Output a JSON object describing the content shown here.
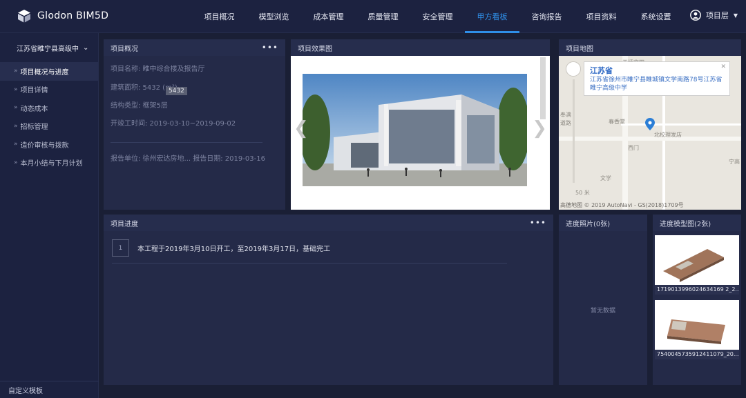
{
  "app": {
    "title": "Glodon BIM5D"
  },
  "nav": {
    "items": [
      "项目概况",
      "模型浏览",
      "成本管理",
      "质量管理",
      "安全管理",
      "甲方看板",
      "咨询报告",
      "项目资料",
      "系统设置"
    ],
    "active": "甲方看板"
  },
  "user": {
    "name": "项目层"
  },
  "sidebar": {
    "org_selector": "江苏省睢宁县高级中",
    "items": [
      {
        "label": "项目概况与进度",
        "active": true
      },
      {
        "label": "项目详情"
      },
      {
        "label": "动态成本"
      },
      {
        "label": "招标管理"
      },
      {
        "label": "造价审核与拨款"
      },
      {
        "label": "本月小结与下月计划"
      }
    ],
    "footer": "自定义模板"
  },
  "overview": {
    "title": "项目概况",
    "name": "项目名称: 睢中综合楼及报告厅",
    "area": "建筑面积: 5432 (m²)",
    "area_tooltip": "5432",
    "structure": "结构类型: 框架5层",
    "dates": "开竣工时间: 2019-03-10~2019-09-02",
    "report": "报告单位: 徐州宏达房地... 报告日期: 2019-03-16"
  },
  "effect": {
    "title": "项目效果图",
    "prev": "❮",
    "next": "❯"
  },
  "map": {
    "title": "项目地图",
    "popup_title": "江苏省",
    "popup_address": "江苏省徐州市睢宁县睢城镇文学南路78号江苏省睢宁高级中学",
    "labels": {
      "top_road": "天桥文四",
      "left_shop": "春香堂",
      "poi": "北校理发店",
      "gate": "西门",
      "lane_a": "奉满",
      "lane_b": "道路",
      "road_vertical": "文学",
      "scale": "50 米",
      "right_edge": "宁高"
    },
    "copyright": "高德地图 © 2019 AutoNavi - GS(2018)1709号"
  },
  "progress": {
    "title": "项目进度",
    "items": [
      {
        "index": "1",
        "text": "本工程于2019年3月10日开工，至2019年3月17日，基础完工"
      }
    ]
  },
  "photos": {
    "title": "进度照片(0张)",
    "empty": "暂无数据"
  },
  "models": {
    "title": "进度模型图(2张)",
    "items": [
      {
        "caption": "1719013996024634169 2_2..."
      },
      {
        "caption": "7540045735912411079_20..."
      }
    ]
  },
  "colors": {
    "accent": "#2f8fe8",
    "background": "#1a1f35",
    "panel": "#242a48"
  }
}
